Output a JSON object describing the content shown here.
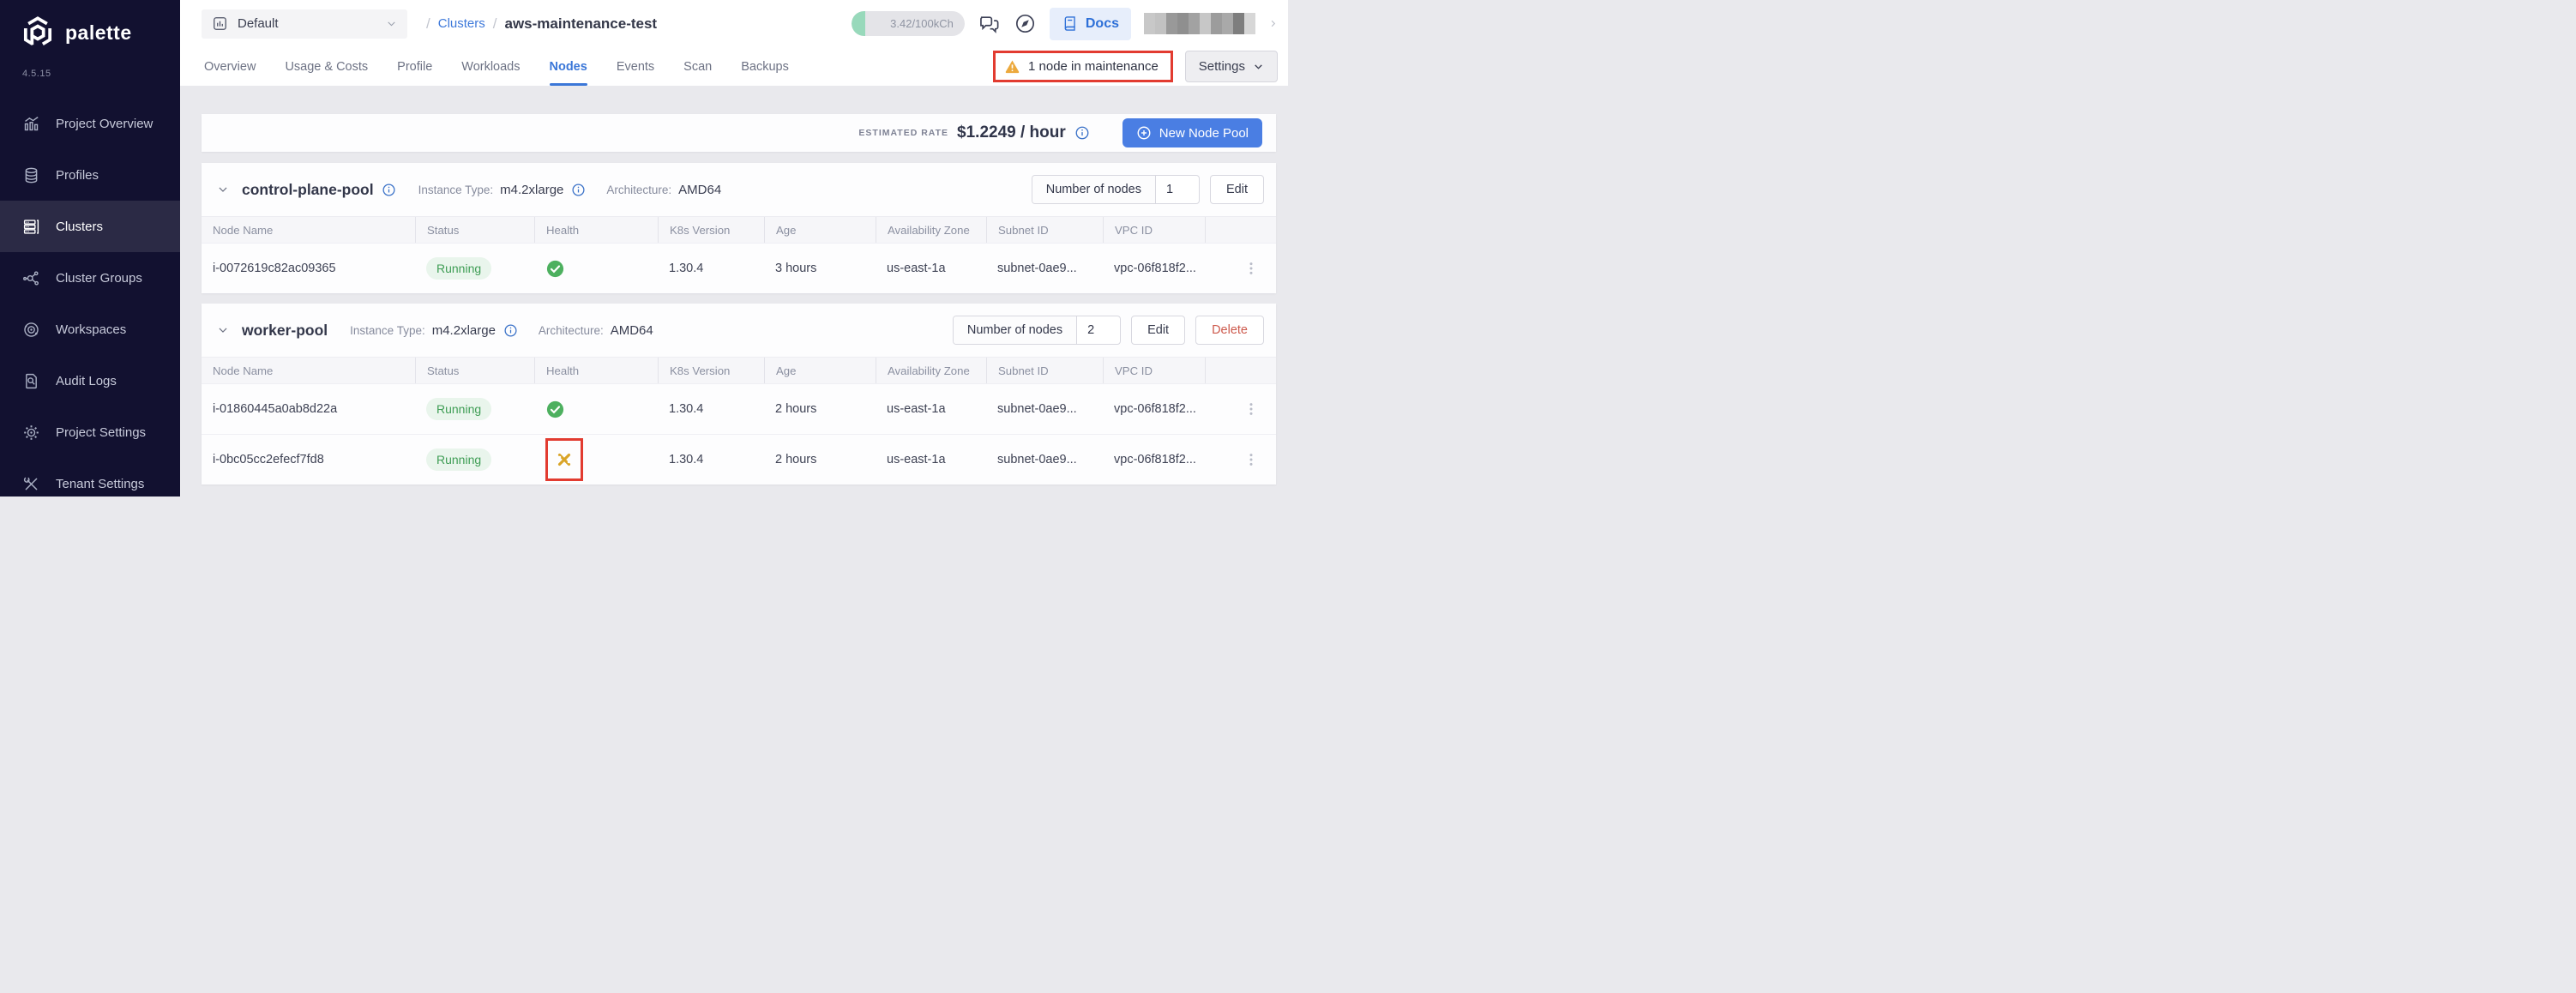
{
  "sidebar": {
    "logo_text": "palette",
    "version": "4.5.15",
    "items": [
      {
        "label": "Project Overview",
        "icon": "bar-chart-icon"
      },
      {
        "label": "Profiles",
        "icon": "layers-icon"
      },
      {
        "label": "Clusters",
        "icon": "servers-icon",
        "active": true
      },
      {
        "label": "Cluster Groups",
        "icon": "network-icon"
      },
      {
        "label": "Workspaces",
        "icon": "orbit-icon"
      },
      {
        "label": "Audit Logs",
        "icon": "doc-search-icon"
      },
      {
        "label": "Project Settings",
        "icon": "gear-icon"
      },
      {
        "label": "Tenant Settings",
        "icon": "tools-icon"
      }
    ]
  },
  "header": {
    "project_selector": "Default",
    "breadcrumb": {
      "separator": "/",
      "section": "Clusters",
      "current": "aws-maintenance-test"
    },
    "usage_badge": "3.42/100kCh",
    "docs_label": "Docs",
    "tabs": [
      "Overview",
      "Usage & Costs",
      "Profile",
      "Workloads",
      "Nodes",
      "Events",
      "Scan",
      "Backups"
    ],
    "active_tab": "Nodes",
    "maintenance_alert": "1 node in maintenance",
    "settings_label": "Settings"
  },
  "toolbar": {
    "estimated_rate_label": "ESTIMATED RATE",
    "estimated_rate_value": "$1.2249 / hour",
    "new_node_pool_label": "New Node Pool"
  },
  "columns": [
    "Node Name",
    "Status",
    "Health",
    "K8s Version",
    "Age",
    "Availability Zone",
    "Subnet ID",
    "VPC ID"
  ],
  "pools": [
    {
      "name": "control-plane-pool",
      "instance_type_label": "Instance Type:",
      "instance_type": "m4.2xlarge",
      "architecture_label": "Architecture:",
      "architecture": "AMD64",
      "nodes_label": "Number of nodes",
      "nodes_count": "1",
      "edit_label": "Edit",
      "rows": [
        {
          "node_name": "i-0072619c82ac09365",
          "status": "Running",
          "health": "healthy-icon",
          "k8s_version": "1.30.4",
          "age": "3 hours",
          "availability_zone": "us-east-1a",
          "subnet_id": "subnet-0ae9...",
          "vpc_id": "vpc-06f818f2..."
        }
      ]
    },
    {
      "name": "worker-pool",
      "instance_type_label": "Instance Type:",
      "instance_type": "m4.2xlarge",
      "architecture_label": "Architecture:",
      "architecture": "AMD64",
      "nodes_label": "Number of nodes",
      "nodes_count": "2",
      "edit_label": "Edit",
      "delete_label": "Delete",
      "rows": [
        {
          "node_name": "i-01860445a0ab8d22a",
          "status": "Running",
          "health": "healthy-icon",
          "k8s_version": "1.30.4",
          "age": "2 hours",
          "availability_zone": "us-east-1a",
          "subnet_id": "subnet-0ae9...",
          "vpc_id": "vpc-06f818f2..."
        },
        {
          "node_name": "i-0bc05cc2efecf7fd8",
          "status": "Running",
          "health": "maintenance-icon",
          "k8s_version": "1.30.4",
          "age": "2 hours",
          "availability_zone": "us-east-1a",
          "subnet_id": "subnet-0ae9...",
          "vpc_id": "vpc-06f818f2..."
        }
      ]
    }
  ],
  "colors": {
    "sidebar_bg": "#121130",
    "accent_blue": "#3b77d8",
    "button_blue": "#4a7ee3",
    "success_green": "#4db05f",
    "warning_amber": "#eca93d",
    "maintenance_amber": "#d9a427",
    "annotation_red": "#e23b30",
    "delete_red": "#cd5a4d"
  }
}
